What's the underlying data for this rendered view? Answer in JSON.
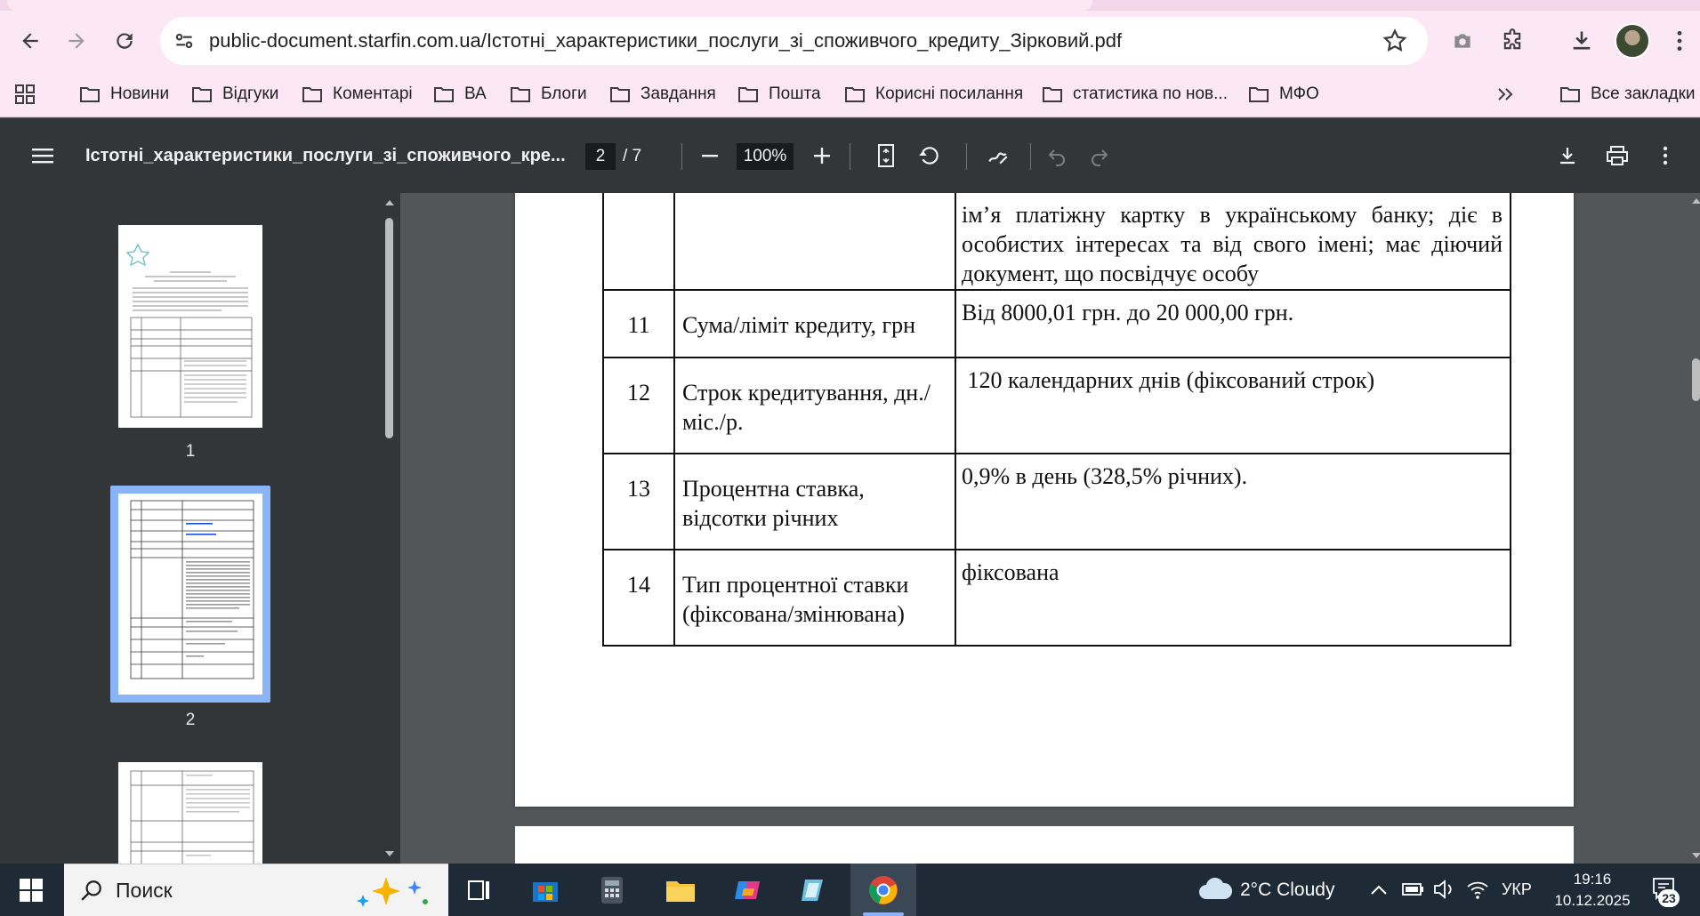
{
  "browser": {
    "url": "public-document.starfin.com.ua/Істотні_характеристики_послуги_зі_споживчого_кредиту_Зірковий.pdf"
  },
  "bookmarks": [
    {
      "label": "Новини"
    },
    {
      "label": "Відгуки"
    },
    {
      "label": "Коментарі"
    },
    {
      "label": "ВА"
    },
    {
      "label": "Блоги"
    },
    {
      "label": "Завдання"
    },
    {
      "label": "Пошта"
    },
    {
      "label": "Корисні посилання"
    },
    {
      "label": "статистика по нов..."
    },
    {
      "label": "МФО"
    }
  ],
  "bookmarks_all_label": "Все закладки",
  "pdf": {
    "title": "Істотні_характеристики_послуги_зі_споживчого_кре...",
    "current_page": "2",
    "page_sep": "/  7",
    "zoom": "100%"
  },
  "thumbnails": [
    {
      "label": "1"
    },
    {
      "label": "2"
    }
  ],
  "document": {
    "rows": [
      {
        "num": "",
        "name": "",
        "value": "ім’я платіжну картку в українському банку; діє в особистих інтересах та від свого імені; має діючий документ, що посвідчує особу"
      },
      {
        "num": "11",
        "name": "Сума/ліміт кредиту, грн",
        "value": "Від 8000,01 грн. до 20 000,00 грн."
      },
      {
        "num": "12",
        "name": "Строк кредитування, дн./міс./р.",
        "value": " 120 календарних днів (фіксований строк)"
      },
      {
        "num": "13",
        "name": "Процентна ставка, відсотки річних",
        "value": "0,9% в день (328,5% річних)."
      },
      {
        "num": "14",
        "name": "Тип процентної ставки (фіксована/змінювана)",
        "value": "фіксована"
      }
    ]
  },
  "taskbar": {
    "search_placeholder": "Поиск",
    "weather": "2°C  Cloudy",
    "language": "УКР",
    "time": "19:16",
    "date": "10.12.2025",
    "notifications": "23"
  }
}
